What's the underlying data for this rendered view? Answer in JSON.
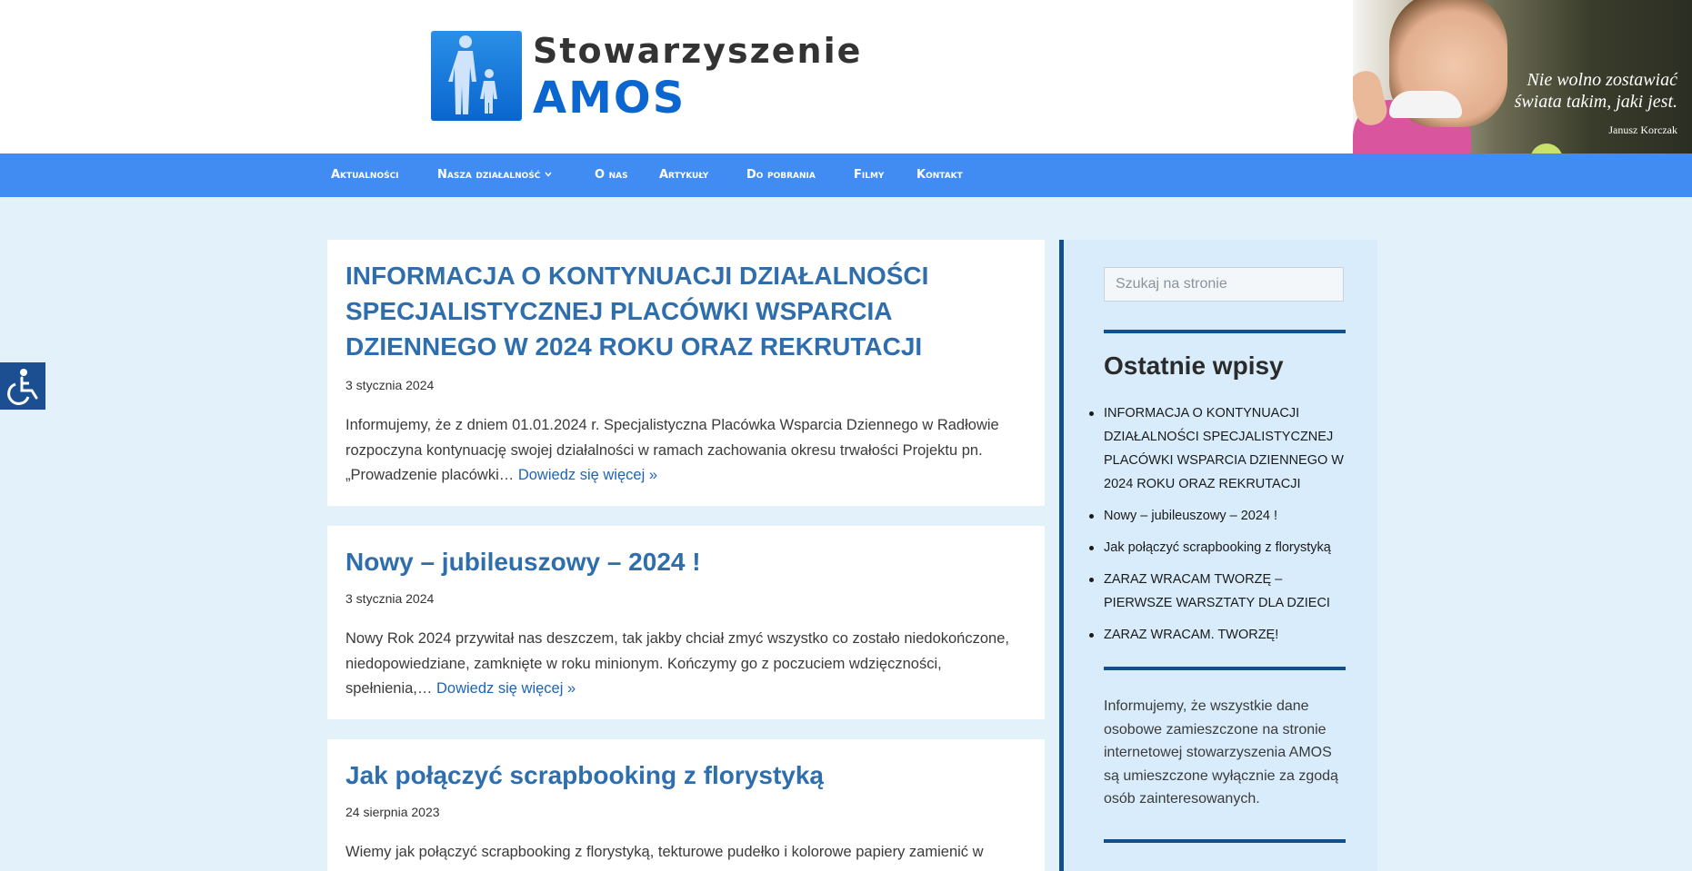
{
  "header": {
    "logo_title": "Stowarzyszenie",
    "logo_name": "AMOS",
    "quote_line1": "Nie wolno zostawiać",
    "quote_line2": "świata takim, jaki jest.",
    "quote_author": "Janusz Korczak"
  },
  "nav": {
    "items": [
      {
        "label": "Aktualności"
      },
      {
        "label": "Nasza działalność"
      },
      {
        "label": "O nas"
      },
      {
        "label": "Artykuły"
      },
      {
        "label": "Do pobrania"
      },
      {
        "label": "Filmy"
      },
      {
        "label": "Kontakt"
      }
    ],
    "dropdown_icon": "chevron-down-icon"
  },
  "accessibility": {
    "icon": "wheelchair-icon"
  },
  "posts": [
    {
      "title": "INFORMACJA O KONTYNUACJI DZIAŁALNOŚCI SPECJALISTYCZNEJ PLACÓWKI WSPARCIA DZIENNEGO W 2024  ROKU ORAZ REKRUTACJI",
      "date": "3 stycznia 2024",
      "excerpt": "Informujemy, że z dniem 01.01.2024 r. Specjalistyczna Placówka Wsparcia Dziennego w Radłowie rozpoczyna kontynuację swojej działalności w ramach zachowania okresu trwałości Projektu pn. „Prowadzenie placówki…",
      "more": "Dowiedz się więcej »"
    },
    {
      "title": "Nowy – jubileuszowy – 2024 !",
      "date": "3 stycznia 2024",
      "excerpt": "Nowy Rok 2024 przywitał nas deszczem, tak jakby chciał zmyć wszystko co zostało niedokończone, niedopowiedziane, zamknięte w roku minionym. Kończymy go z poczuciem wdzięczności, spełnienia,…",
      "more": "Dowiedz się więcej »"
    },
    {
      "title": "Jak połączyć scrapbooking z florystyką",
      "date": "24 sierpnia 2023",
      "excerpt": "Wiemy jak połączyć scrapbooking z florystyką, tekturowe pudełko i kolorowe papiery zamienić w"
    }
  ],
  "sidebar": {
    "search_placeholder": "Szukaj na stronie",
    "recent_heading": "Ostatnie wpisy",
    "recent": [
      "INFORMACJA O KONTYNUACJI DZIAŁALNOŚCI SPECJALISTYCZNEJ PLACÓWKI WSPARCIA DZIENNEGO W 2024  ROKU ORAZ REKRUTACJI",
      "Nowy – jubileuszowy – 2024 !",
      "Jak połączyć scrapbooking z florystyką",
      "ZARAZ WRACAM TWORZĘ – PIERWSZE WARSZTATY DLA DZIECI",
      "ZARAZ WRACAM. TWORZĘ!"
    ],
    "note": "Informujemy, że wszystkie dane osobowe zamieszczone na stronie internetowej stowarzyszenia AMOS są umieszczone wyłącznie za zgodą osób zainteresowanych."
  },
  "colors": {
    "page_bg": "#e3f1fb",
    "nav_bg": "#418cf3",
    "title_blue": "#2f6ead",
    "link_blue": "#1e64b4",
    "sidebar_bg": "#d8ecfb",
    "sidebar_rule": "#10508d",
    "logo_blue": "#0b66cf"
  }
}
